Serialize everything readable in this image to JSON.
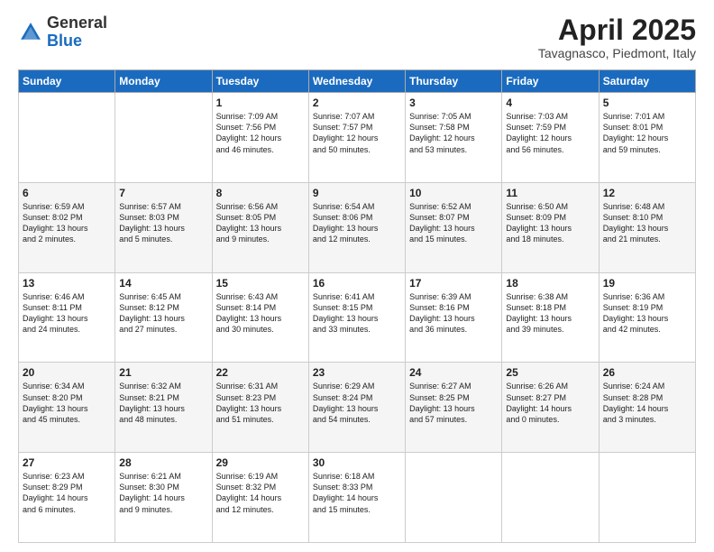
{
  "header": {
    "logo_general": "General",
    "logo_blue": "Blue",
    "month": "April 2025",
    "location": "Tavagnasco, Piedmont, Italy"
  },
  "days_of_week": [
    "Sunday",
    "Monday",
    "Tuesday",
    "Wednesday",
    "Thursday",
    "Friday",
    "Saturday"
  ],
  "weeks": [
    [
      {
        "day": "",
        "content": ""
      },
      {
        "day": "",
        "content": ""
      },
      {
        "day": "1",
        "content": "Sunrise: 7:09 AM\nSunset: 7:56 PM\nDaylight: 12 hours\nand 46 minutes."
      },
      {
        "day": "2",
        "content": "Sunrise: 7:07 AM\nSunset: 7:57 PM\nDaylight: 12 hours\nand 50 minutes."
      },
      {
        "day": "3",
        "content": "Sunrise: 7:05 AM\nSunset: 7:58 PM\nDaylight: 12 hours\nand 53 minutes."
      },
      {
        "day": "4",
        "content": "Sunrise: 7:03 AM\nSunset: 7:59 PM\nDaylight: 12 hours\nand 56 minutes."
      },
      {
        "day": "5",
        "content": "Sunrise: 7:01 AM\nSunset: 8:01 PM\nDaylight: 12 hours\nand 59 minutes."
      }
    ],
    [
      {
        "day": "6",
        "content": "Sunrise: 6:59 AM\nSunset: 8:02 PM\nDaylight: 13 hours\nand 2 minutes."
      },
      {
        "day": "7",
        "content": "Sunrise: 6:57 AM\nSunset: 8:03 PM\nDaylight: 13 hours\nand 5 minutes."
      },
      {
        "day": "8",
        "content": "Sunrise: 6:56 AM\nSunset: 8:05 PM\nDaylight: 13 hours\nand 9 minutes."
      },
      {
        "day": "9",
        "content": "Sunrise: 6:54 AM\nSunset: 8:06 PM\nDaylight: 13 hours\nand 12 minutes."
      },
      {
        "day": "10",
        "content": "Sunrise: 6:52 AM\nSunset: 8:07 PM\nDaylight: 13 hours\nand 15 minutes."
      },
      {
        "day": "11",
        "content": "Sunrise: 6:50 AM\nSunset: 8:09 PM\nDaylight: 13 hours\nand 18 minutes."
      },
      {
        "day": "12",
        "content": "Sunrise: 6:48 AM\nSunset: 8:10 PM\nDaylight: 13 hours\nand 21 minutes."
      }
    ],
    [
      {
        "day": "13",
        "content": "Sunrise: 6:46 AM\nSunset: 8:11 PM\nDaylight: 13 hours\nand 24 minutes."
      },
      {
        "day": "14",
        "content": "Sunrise: 6:45 AM\nSunset: 8:12 PM\nDaylight: 13 hours\nand 27 minutes."
      },
      {
        "day": "15",
        "content": "Sunrise: 6:43 AM\nSunset: 8:14 PM\nDaylight: 13 hours\nand 30 minutes."
      },
      {
        "day": "16",
        "content": "Sunrise: 6:41 AM\nSunset: 8:15 PM\nDaylight: 13 hours\nand 33 minutes."
      },
      {
        "day": "17",
        "content": "Sunrise: 6:39 AM\nSunset: 8:16 PM\nDaylight: 13 hours\nand 36 minutes."
      },
      {
        "day": "18",
        "content": "Sunrise: 6:38 AM\nSunset: 8:18 PM\nDaylight: 13 hours\nand 39 minutes."
      },
      {
        "day": "19",
        "content": "Sunrise: 6:36 AM\nSunset: 8:19 PM\nDaylight: 13 hours\nand 42 minutes."
      }
    ],
    [
      {
        "day": "20",
        "content": "Sunrise: 6:34 AM\nSunset: 8:20 PM\nDaylight: 13 hours\nand 45 minutes."
      },
      {
        "day": "21",
        "content": "Sunrise: 6:32 AM\nSunset: 8:21 PM\nDaylight: 13 hours\nand 48 minutes."
      },
      {
        "day": "22",
        "content": "Sunrise: 6:31 AM\nSunset: 8:23 PM\nDaylight: 13 hours\nand 51 minutes."
      },
      {
        "day": "23",
        "content": "Sunrise: 6:29 AM\nSunset: 8:24 PM\nDaylight: 13 hours\nand 54 minutes."
      },
      {
        "day": "24",
        "content": "Sunrise: 6:27 AM\nSunset: 8:25 PM\nDaylight: 13 hours\nand 57 minutes."
      },
      {
        "day": "25",
        "content": "Sunrise: 6:26 AM\nSunset: 8:27 PM\nDaylight: 14 hours\nand 0 minutes."
      },
      {
        "day": "26",
        "content": "Sunrise: 6:24 AM\nSunset: 8:28 PM\nDaylight: 14 hours\nand 3 minutes."
      }
    ],
    [
      {
        "day": "27",
        "content": "Sunrise: 6:23 AM\nSunset: 8:29 PM\nDaylight: 14 hours\nand 6 minutes."
      },
      {
        "day": "28",
        "content": "Sunrise: 6:21 AM\nSunset: 8:30 PM\nDaylight: 14 hours\nand 9 minutes."
      },
      {
        "day": "29",
        "content": "Sunrise: 6:19 AM\nSunset: 8:32 PM\nDaylight: 14 hours\nand 12 minutes."
      },
      {
        "day": "30",
        "content": "Sunrise: 6:18 AM\nSunset: 8:33 PM\nDaylight: 14 hours\nand 15 minutes."
      },
      {
        "day": "",
        "content": ""
      },
      {
        "day": "",
        "content": ""
      },
      {
        "day": "",
        "content": ""
      }
    ]
  ]
}
